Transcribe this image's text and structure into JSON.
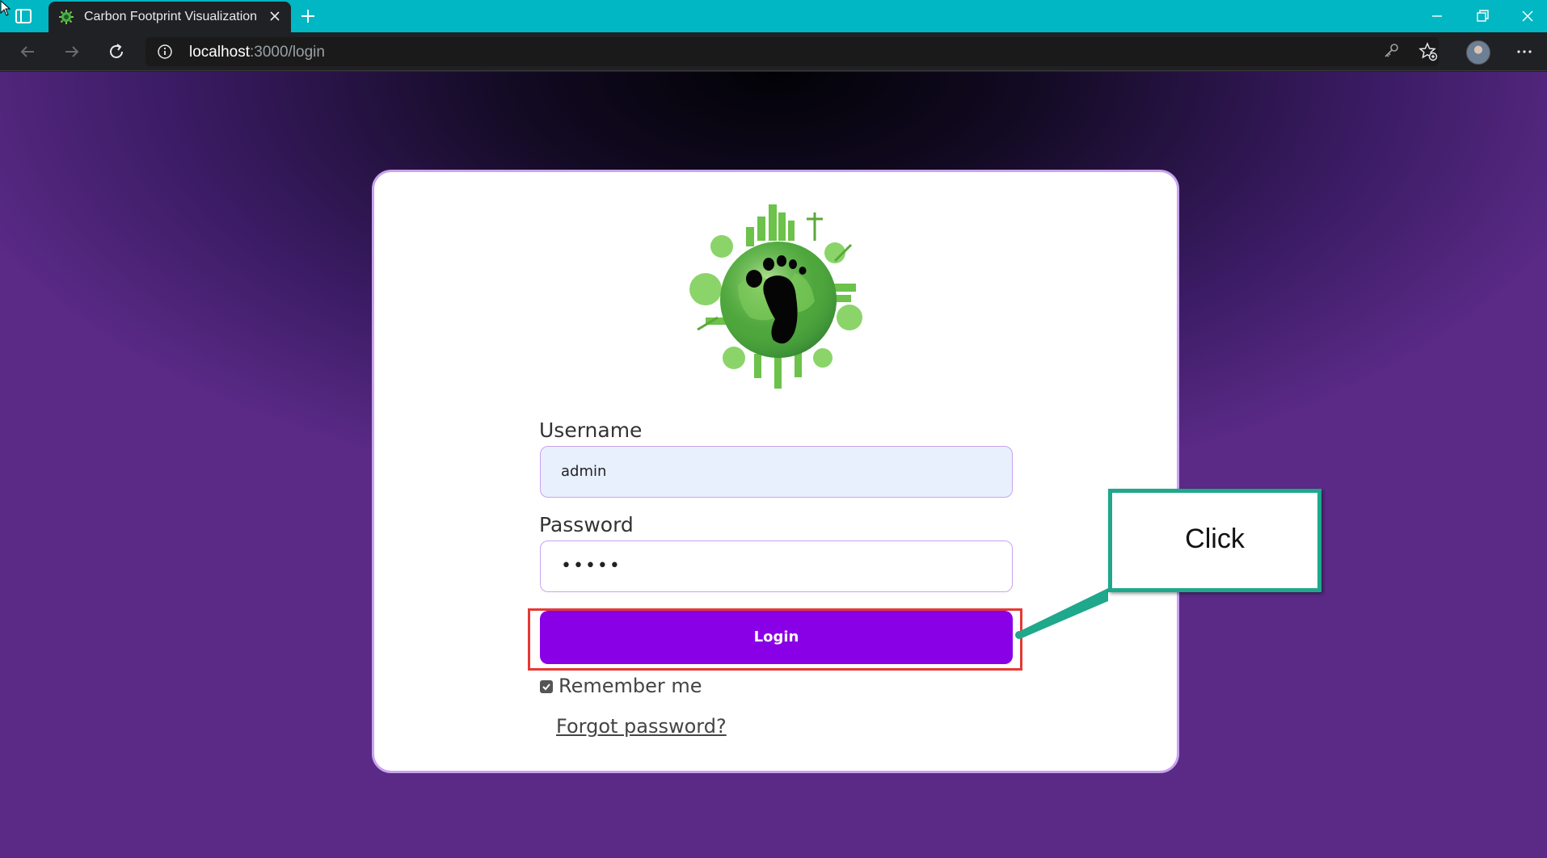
{
  "browser": {
    "tab_title": "Carbon Footprint Visualization",
    "url_host": "localhost",
    "url_path": ":3000/login"
  },
  "login": {
    "username_label": "Username",
    "username_value": "admin",
    "password_label": "Password",
    "password_value": "•••••",
    "login_button": "Login",
    "remember_label": "Remember me",
    "remember_checked": true,
    "forgot_link": "Forgot password?"
  },
  "annotation": {
    "callout_text": "Click"
  },
  "colors": {
    "titlebar": "#00b7c3",
    "button": "#8a00e6",
    "card_border": "#c9a3ef",
    "highlight": "#e53935",
    "callout_border": "#1fa88b"
  },
  "icons": [
    "sidebar-toggle-icon",
    "leaf-favicon",
    "close-icon",
    "plus-icon",
    "minimize-icon",
    "restore-icon",
    "window-close-icon",
    "back-arrow-icon",
    "forward-arrow-icon",
    "refresh-icon",
    "info-icon",
    "key-icon",
    "favorites-icon",
    "more-icon",
    "checkbox-checked-icon"
  ]
}
